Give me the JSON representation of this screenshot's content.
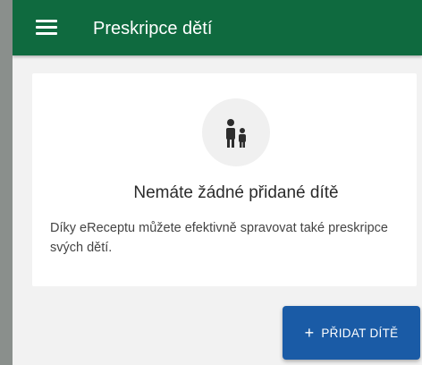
{
  "app_bar": {
    "title": "Preskripce dětí",
    "menu_icon": "hamburger-menu-icon",
    "background_color": "#0f6a3f"
  },
  "empty_state": {
    "icon": "children-icon",
    "title": "Nemáte žádné přidané dítě",
    "description": "Díky eReceptu můžete efektivně spravovat také preskripce svých dětí."
  },
  "actions": {
    "add_child_icon": "+",
    "add_child_label": "PŘIDAT DÍTĚ",
    "button_color": "#1a5ba6"
  }
}
